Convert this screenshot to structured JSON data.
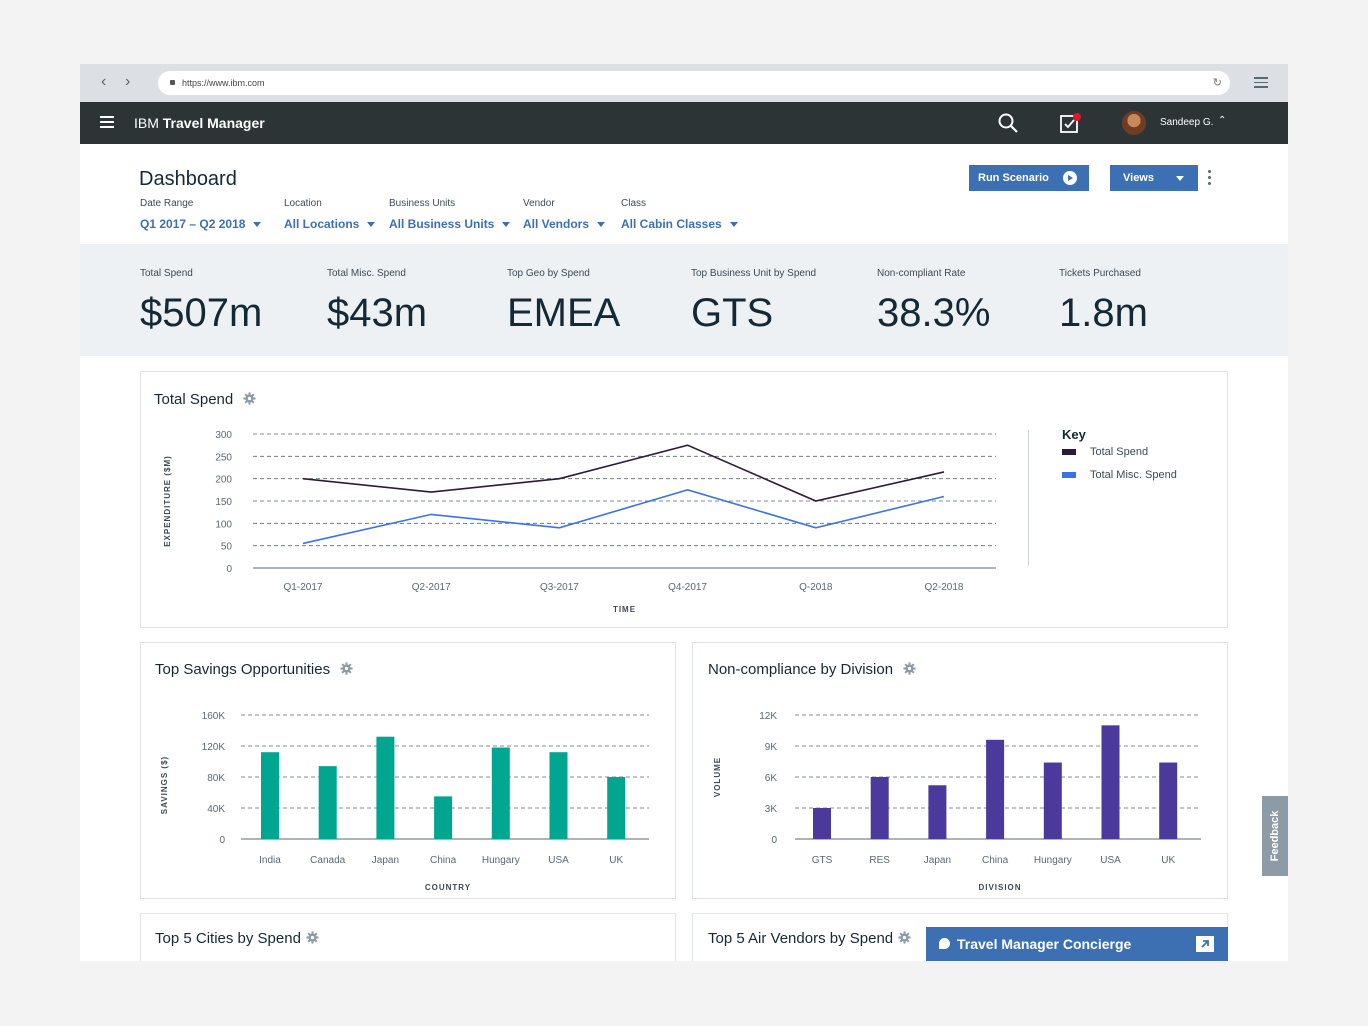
{
  "browser": {
    "url": "https://www.ibm.com"
  },
  "app": {
    "brand_prefix": "IBM",
    "brand_name": "Travel Manager",
    "user_name": "Sandeep G."
  },
  "dashboard": {
    "title": "Dashboard",
    "run_scenario_label": "Run Scenario",
    "views_label": "Views",
    "filters": [
      {
        "label": "Date Range",
        "value": "Q1 2017 – Q2 2018"
      },
      {
        "label": "Location",
        "value": "All Locations"
      },
      {
        "label": "Business Units",
        "value": "All Business Units"
      },
      {
        "label": "Vendor",
        "value": "All Vendors"
      },
      {
        "label": "Class",
        "value": "All Cabin Classes"
      }
    ]
  },
  "kpis": [
    {
      "label": "Total Spend",
      "value": "$507m"
    },
    {
      "label": "Total Misc. Spend",
      "value": "$43m"
    },
    {
      "label": "Top Geo by Spend",
      "value": "EMEA"
    },
    {
      "label": "Top Business Unit by Spend",
      "value": "GTS"
    },
    {
      "label": "Non-compliant Rate",
      "value": "38.3%"
    },
    {
      "label": "Tickets Purchased",
      "value": "1.8m"
    }
  ],
  "colors": {
    "accent": "#3d70b2",
    "total_spend": "#2d1a3a",
    "misc_spend": "#3b73e6",
    "teal": "#00a68f",
    "purple": "#4b3a9b"
  },
  "chart_data": [
    {
      "type": "line",
      "title": "Total Spend",
      "x": [
        "Q1-2017",
        "Q2-2017",
        "Q3-2017",
        "Q4-2017",
        "Q-2018",
        "Q2-2018"
      ],
      "series": [
        {
          "name": "Total Spend",
          "values": [
            200,
            170,
            200,
            275,
            150,
            215
          ]
        },
        {
          "name": "Total Misc. Spend",
          "values": [
            55,
            120,
            90,
            175,
            90,
            160
          ]
        }
      ],
      "xlabel": "TIME",
      "ylabel": "EXPENDITURE ($M)",
      "yticks": [
        0,
        50,
        100,
        150,
        200,
        250,
        300
      ],
      "ylim": [
        0,
        300
      ],
      "legend_title": "Key",
      "legend": "right",
      "grid": true
    },
    {
      "type": "bar",
      "title": "Top Savings Opportunities",
      "categories": [
        "India",
        "Canada",
        "Japan",
        "China",
        "Hungary",
        "USA",
        "UK"
      ],
      "values": [
        112000,
        94000,
        132000,
        55000,
        118000,
        112000,
        80000
      ],
      "xlabel": "COUNTRY",
      "ylabel": "SAVINGS ($)",
      "yticks": [
        0,
        40000,
        80000,
        120000,
        160000
      ],
      "ytick_labels": [
        "0",
        "40K",
        "80K",
        "120K",
        "160K"
      ],
      "ylim": [
        0,
        160000
      ],
      "grid": true
    },
    {
      "type": "bar",
      "title": "Non-compliance by Division",
      "categories": [
        "GTS",
        "RES",
        "Japan",
        "China",
        "Hungary",
        "USA",
        "UK"
      ],
      "values": [
        3000,
        6000,
        5200,
        9600,
        7400,
        11000,
        7400
      ],
      "xlabel": "DIVISION",
      "ylabel": "VOLUME",
      "yticks": [
        0,
        3000,
        6000,
        9000,
        12000
      ],
      "ytick_labels": [
        "0",
        "3K",
        "6K",
        "9K",
        "12K"
      ],
      "ylim": [
        0,
        12000
      ],
      "grid": true
    }
  ],
  "bottom_cards": {
    "cities_title": "Top 5 Cities by Spend",
    "vendors_title": "Top 5 Air Vendors by Spend"
  },
  "feedback_label": "Feedback",
  "concierge_label": "Travel Manager Concierge"
}
